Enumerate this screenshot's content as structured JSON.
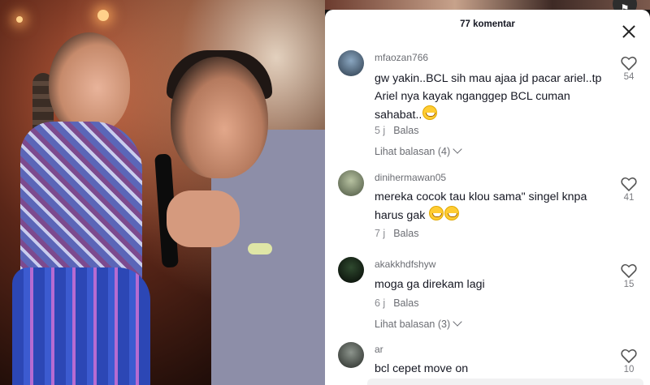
{
  "panel": {
    "title": "77 komentar"
  },
  "comments": [
    {
      "username": "mfaozan766",
      "text": "gw yakin..BCL sih mau ajaa jd pacar ariel..tp Ariel nya kayak nganggep BCL cuman sahabat..",
      "emojis": [
        "grin"
      ],
      "time": "5 j",
      "reply_label": "Balas",
      "likes": "54",
      "view_replies": "Lihat balasan (4)",
      "avatar_color": "#4a6b8a"
    },
    {
      "username": "dinihermawan05",
      "text": "mereka cocok tau klou sama\" singel knpa harus gak",
      "emojis": [
        "grin",
        "grin"
      ],
      "time": "7 j",
      "reply_label": "Balas",
      "likes": "41",
      "view_replies": "",
      "avatar_color": "#6f7a5a"
    },
    {
      "username": "akakkhdfshyw",
      "text": "moga ga direkam lagi",
      "emojis": [],
      "time": "6 j",
      "reply_label": "Balas",
      "likes": "15",
      "view_replies": "Lihat balasan (3)",
      "avatar_color": "#1c2a1c"
    },
    {
      "username": "ar",
      "text": "bcl cepet move on",
      "emojis": [],
      "time": "",
      "reply_label": "",
      "likes": "10",
      "view_replies": "",
      "avatar_color": "#3a3f3a"
    }
  ]
}
